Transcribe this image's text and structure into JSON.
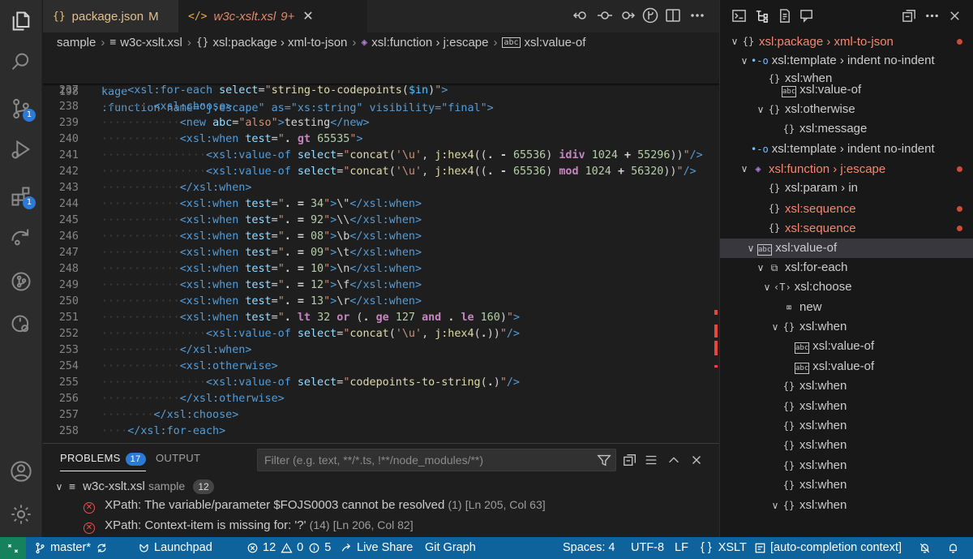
{
  "activity_bar": {
    "scm_badge": "1",
    "extensions_badge": "1"
  },
  "tabs": [
    {
      "icon": "{}",
      "label": "package.json",
      "status": "M"
    },
    {
      "icon": "</>",
      "label": "w3c-xslt.xsl",
      "status": "9+",
      "close": "✕"
    }
  ],
  "breadcrumb": {
    "items": [
      "sample",
      "w3c-xslt.xsl",
      "xsl:package › xml-to-json",
      "xsl:function › j:escape",
      "xsl:value-of"
    ]
  },
  "editor": {
    "sticky_lines": [
      {
        "num": "14",
        "text": "kage"
      },
      {
        "num": "198",
        "text": ":function name=\"j:escape\" as=\"xs:string\" visibility=\"final\">"
      }
    ],
    "line_numbers": [
      "237",
      "238",
      "239",
      "240",
      "241",
      "242",
      "243",
      "244",
      "245",
      "246",
      "247",
      "248",
      "249",
      "250",
      "251",
      "252",
      "253",
      "254",
      "255",
      "256",
      "257",
      "258"
    ]
  },
  "panel": {
    "tabs": {
      "problems": "PROBLEMS",
      "problems_count": "17",
      "output": "OUTPUT"
    },
    "filter_placeholder": "Filter (e.g. text, **/*.ts, !**/node_modules/**)",
    "file": {
      "name": "w3c-xslt.xsl",
      "folder": "sample",
      "count": "12"
    },
    "problems": [
      {
        "message": "XPath: The variable/parameter $FOJS0003 cannot be resolved",
        "count": "(1)",
        "location": "[Ln 205, Col 63]"
      },
      {
        "message": "XPath: Context-item is missing for: '?'",
        "count": "(14)",
        "location": "[Ln 206, Col 82]"
      }
    ]
  },
  "outline": {
    "items": [
      {
        "label": "xsl:package › xml-to-json",
        "icon": "{}",
        "err": true,
        "dot": true,
        "chev": "∨"
      },
      {
        "label": "xsl:template › indent no-indent",
        "icon": "•-o",
        "chev": "∨"
      },
      {
        "label": "xsl:when",
        "icon": "{}"
      },
      {
        "label": "xsl:value-of",
        "icon": "abc"
      },
      {
        "label": "xsl:otherwise",
        "icon": "{}",
        "chev": "∨"
      },
      {
        "label": "xsl:message",
        "icon": "{}"
      },
      {
        "label": "xsl:template › indent no-indent",
        "icon": "•-o"
      },
      {
        "label": "xsl:function › j:escape",
        "icon": "◈",
        "err": true,
        "dot": true,
        "chev": "∨"
      },
      {
        "label": "xsl:param › in",
        "icon": "{}"
      },
      {
        "label": "xsl:sequence",
        "icon": "{}",
        "err": true,
        "dot": true
      },
      {
        "label": "xsl:sequence",
        "icon": "{}",
        "err": true,
        "dot": true
      },
      {
        "label": "xsl:value-of",
        "icon": "abc",
        "chev": "∨"
      },
      {
        "label": "xsl:for-each",
        "icon": "⧉",
        "chev": "∨"
      },
      {
        "label": "xsl:choose",
        "icon": "‹T›",
        "chev": "∨"
      },
      {
        "label": "new",
        "icon": "⌧"
      },
      {
        "label": "xsl:when",
        "icon": "{}",
        "chev": "∨"
      },
      {
        "label": "xsl:value-of",
        "icon": "abc"
      },
      {
        "label": "xsl:value-of",
        "icon": "abc"
      },
      {
        "label": "xsl:when",
        "icon": "{}"
      },
      {
        "label": "xsl:when",
        "icon": "{}"
      },
      {
        "label": "xsl:when",
        "icon": "{}"
      },
      {
        "label": "xsl:when",
        "icon": "{}"
      },
      {
        "label": "xsl:when",
        "icon": "{}"
      },
      {
        "label": "xsl:when",
        "icon": "{}"
      },
      {
        "label": "xsl:when",
        "icon": "{}",
        "chev": "∨"
      }
    ]
  },
  "status_bar": {
    "branch": "master*",
    "launchpad": "Launchpad",
    "errors": "12",
    "warnings": "0",
    "info": "5",
    "live_share": "Live Share",
    "git_graph": "Git Graph",
    "spaces": "Spaces: 4",
    "encoding": "UTF-8",
    "eol": "LF",
    "language_icon": "{ }",
    "language": "XSLT",
    "context": "[auto-completion context]"
  },
  "colors": {
    "accent": "#0e639c",
    "error": "#f14c4c",
    "badge": "#2d7ad6"
  }
}
